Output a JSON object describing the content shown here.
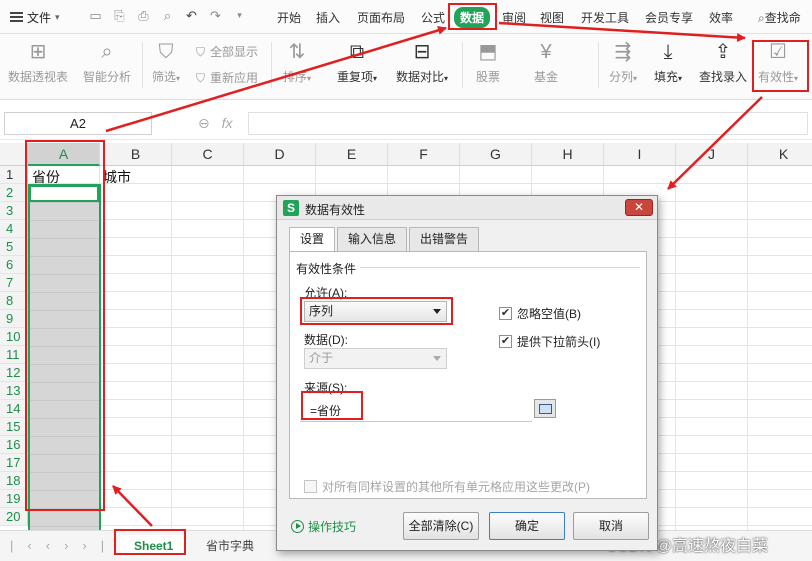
{
  "menubar": {
    "file_label": "文件",
    "tabs": [
      {
        "label": "开始"
      },
      {
        "label": "插入"
      },
      {
        "label": "页面布局"
      },
      {
        "label": "公式"
      },
      {
        "label": "数据"
      },
      {
        "label": "审阅"
      },
      {
        "label": "视图"
      },
      {
        "label": "开发工具"
      },
      {
        "label": "会员专享"
      },
      {
        "label": "效率"
      }
    ],
    "active_tab": "数据",
    "search_label": "查找命"
  },
  "ribbon": {
    "pivot": "数据透视表",
    "smart_analysis": "智能分析",
    "filter": "筛选",
    "show_all": "全部显示",
    "reapply": "重新应用",
    "sort": "排序",
    "duplicates": "重复项",
    "compare": "数据对比",
    "stock": "股票",
    "fund": "基金",
    "split": "分列",
    "fill": "填充",
    "lookup_entry": "查找录入",
    "validity": "有效性"
  },
  "formula_bar": {
    "name_box": "A2",
    "fx_label": "fx",
    "content": ""
  },
  "grid": {
    "columns": [
      "A",
      "B",
      "C",
      "D",
      "E",
      "F",
      "G",
      "H",
      "I",
      "J",
      "K"
    ],
    "selected_column": "A",
    "rows": [
      "1",
      "2",
      "3",
      "4",
      "5",
      "6",
      "7",
      "8",
      "9",
      "10",
      "11",
      "12",
      "13",
      "14",
      "15",
      "16",
      "17",
      "18",
      "19",
      "20"
    ],
    "cells": {
      "A1": "省份",
      "B1": "城市"
    }
  },
  "sheets": {
    "tabs": [
      "Sheet1",
      "省市字典"
    ],
    "active": "Sheet1"
  },
  "dialog": {
    "title": "数据有效性",
    "close_label": "✕",
    "tabs": [
      "设置",
      "输入信息",
      "出错警告"
    ],
    "active_tab": "设置",
    "section_title": "有效性条件",
    "allow_label": "允许(A):",
    "allow_value": "序列",
    "data_label": "数据(D):",
    "data_value": "介于",
    "ignore_blank_label": "忽略空值(B)",
    "ignore_blank_checked": true,
    "dropdown_label": "提供下拉箭头(I)",
    "dropdown_checked": true,
    "source_label": "来源(S):",
    "source_value": "=省份",
    "apply_all_label": "对所有同样设置的其他所有单元格应用这些更改(P)",
    "apply_all_checked": false,
    "tips_label": "操作技巧",
    "clear_all_label": "全部清除(C)",
    "ok_label": "确定",
    "cancel_label": "取消"
  },
  "watermark": "CSDN @高速熬夜白菜",
  "colors": {
    "accent_green": "#22a35a",
    "annotation_red": "#e02020"
  }
}
